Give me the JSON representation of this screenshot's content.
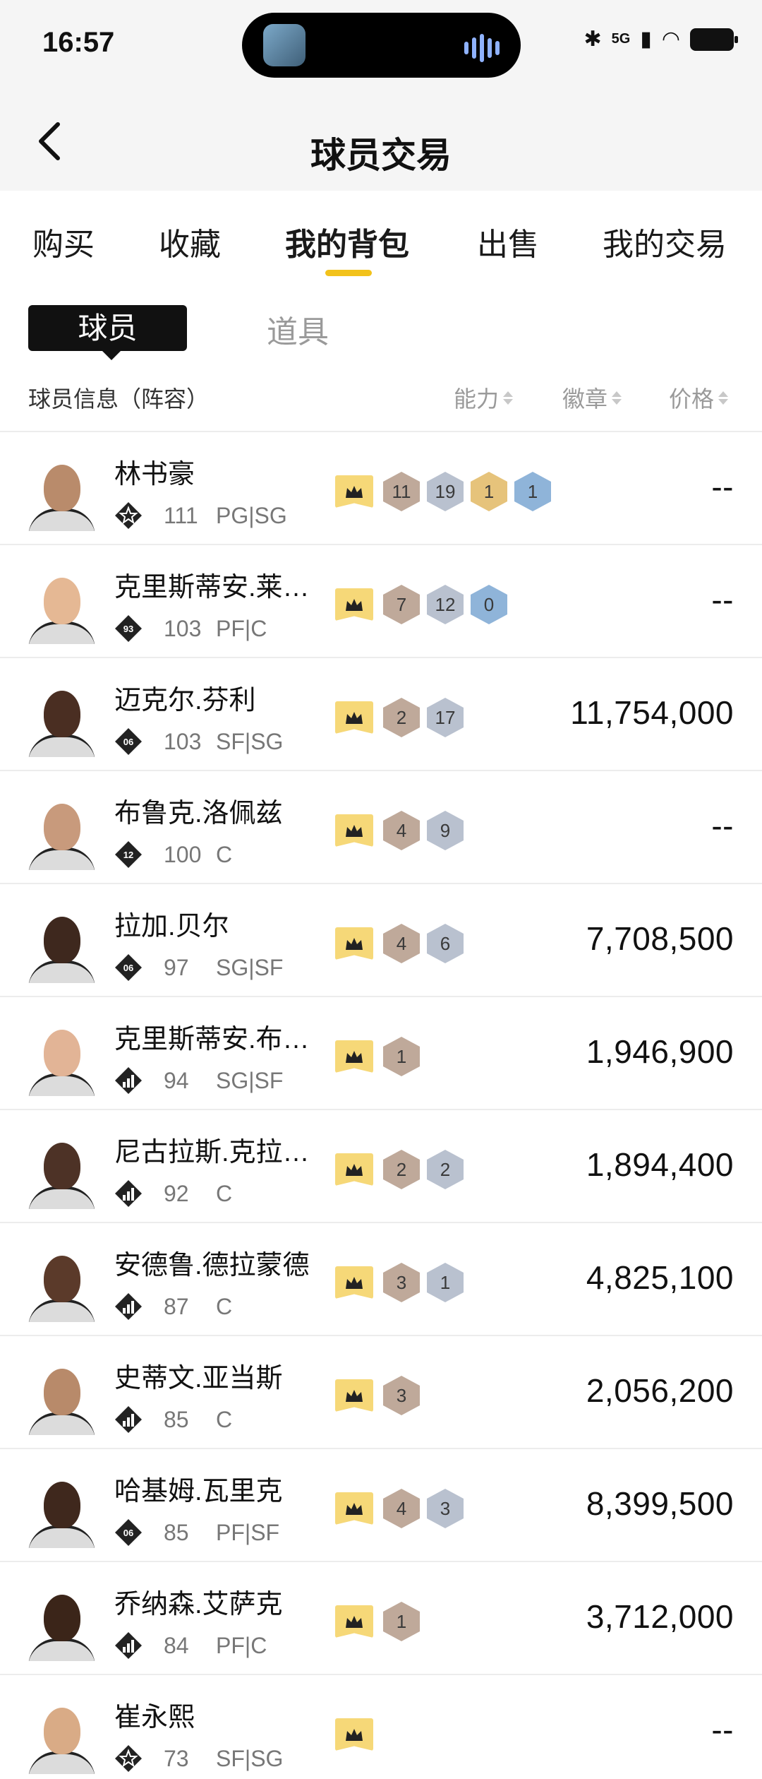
{
  "status_bar": {
    "time": "16:57",
    "network": "5G"
  },
  "header": {
    "title": "球员交易"
  },
  "tabs": [
    {
      "label": "购买"
    },
    {
      "label": "收藏"
    },
    {
      "label": "我的背包"
    },
    {
      "label": "出售"
    },
    {
      "label": "我的交易"
    }
  ],
  "active_tab": "我的背包",
  "subtabs": {
    "active": "球员",
    "other": "道具"
  },
  "columns": {
    "info": "球员信息（阵容）",
    "ability": "能力",
    "badge": "徽章",
    "price": "价格"
  },
  "colors": {
    "accent": "#f2c21b",
    "crown_bg": "#f6d878",
    "bronze": "#bfa99a",
    "silver": "#b9c1cf",
    "gold": "#e6c37b",
    "hof": "#8fb4d9"
  },
  "players": [
    {
      "name": "林书豪",
      "tier": "star",
      "ovr": "111",
      "pos": "PG|SG",
      "badges": [
        "11",
        "19",
        "1",
        "1"
      ],
      "badge_tiers": [
        "bronze",
        "silver",
        "gold",
        "hof"
      ],
      "price": "--",
      "skin": "#b98b6b"
    },
    {
      "name": "克里斯蒂安.莱…",
      "tier": "93",
      "ovr": "103",
      "pos": "PF|C",
      "badges": [
        "7",
        "12",
        "0"
      ],
      "badge_tiers": [
        "bronze",
        "silver",
        "hof"
      ],
      "price": "--",
      "skin": "#e5b894"
    },
    {
      "name": "迈克尔.芬利",
      "tier": "06",
      "ovr": "103",
      "pos": "SF|SG",
      "badges": [
        "2",
        "17"
      ],
      "badge_tiers": [
        "bronze",
        "silver"
      ],
      "price": "11,754,000",
      "skin": "#4a2e22"
    },
    {
      "name": "布鲁克.洛佩兹",
      "tier": "12",
      "ovr": "100",
      "pos": "C",
      "badges": [
        "4",
        "9"
      ],
      "badge_tiers": [
        "bronze",
        "silver"
      ],
      "price": "--",
      "skin": "#c89a7c"
    },
    {
      "name": "拉加.贝尔",
      "tier": "06",
      "ovr": "97",
      "pos": "SG|SF",
      "badges": [
        "4",
        "6"
      ],
      "badge_tiers": [
        "bronze",
        "silver"
      ],
      "price": "7,708,500",
      "skin": "#3e281e"
    },
    {
      "name": "克里斯蒂安.布…",
      "tier": "bars",
      "ovr": "94",
      "pos": "SG|SF",
      "badges": [
        "1"
      ],
      "badge_tiers": [
        "bronze"
      ],
      "price": "1,946,900",
      "skin": "#e2b496"
    },
    {
      "name": "尼古拉斯.克拉…",
      "tier": "bars",
      "ovr": "92",
      "pos": "C",
      "badges": [
        "2",
        "2"
      ],
      "badge_tiers": [
        "bronze",
        "silver"
      ],
      "price": "1,894,400",
      "skin": "#4d3226"
    },
    {
      "name": "安德鲁.德拉蒙德",
      "tier": "bars",
      "ovr": "87",
      "pos": "C",
      "badges": [
        "3",
        "1"
      ],
      "badge_tiers": [
        "bronze",
        "silver"
      ],
      "price": "4,825,100",
      "skin": "#5b3a2a"
    },
    {
      "name": "史蒂文.亚当斯",
      "tier": "bars",
      "ovr": "85",
      "pos": "C",
      "badges": [
        "3"
      ],
      "badge_tiers": [
        "bronze"
      ],
      "price": "2,056,200",
      "skin": "#b88a6a"
    },
    {
      "name": "哈基姆.瓦里克",
      "tier": "06",
      "ovr": "85",
      "pos": "PF|SF",
      "badges": [
        "4",
        "3"
      ],
      "badge_tiers": [
        "bronze",
        "silver"
      ],
      "price": "8,399,500",
      "skin": "#3f281d"
    },
    {
      "name": "乔纳森.艾萨克",
      "tier": "bars",
      "ovr": "84",
      "pos": "PF|C",
      "badges": [
        "1"
      ],
      "badge_tiers": [
        "bronze"
      ],
      "price": "3,712,000",
      "skin": "#3b2519"
    },
    {
      "name": "崔永熙",
      "tier": "star",
      "ovr": "73",
      "pos": "SF|SG",
      "badges": [],
      "badge_tiers": [],
      "price": "--",
      "skin": "#d9ab86"
    }
  ]
}
